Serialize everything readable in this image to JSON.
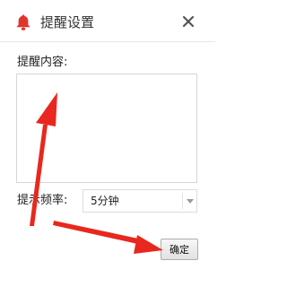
{
  "window": {
    "title": "提醒设置",
    "icon": "bell-icon",
    "accent_color": "#e0352b"
  },
  "form": {
    "content_label": "提醒内容:",
    "content_value": "",
    "frequency_label": "提示频率:",
    "frequency_selected": "5分钟"
  },
  "actions": {
    "ok_label": "确定"
  },
  "annotations": {
    "color": "#e8281e",
    "arrows": [
      "arrow-to-content-textarea",
      "arrow-to-ok-button"
    ]
  }
}
